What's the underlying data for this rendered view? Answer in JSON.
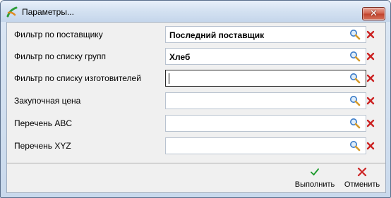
{
  "window": {
    "title": "Параметры..."
  },
  "filters": [
    {
      "label": "Фильтр по поставщику",
      "value": "Последний поставщик"
    },
    {
      "label": "Фильтр по списку групп",
      "value": "Хлеб"
    },
    {
      "label": "Фильтр по списку изготовителей",
      "value": ""
    },
    {
      "label": "Закупочная цена",
      "value": ""
    },
    {
      "label": "Перечень ABC",
      "value": ""
    },
    {
      "label": "Перечень XYZ",
      "value": ""
    }
  ],
  "actions": {
    "execute_label": "Выполнить",
    "cancel_label": "Отменить"
  },
  "icons": {
    "app": "app-logo-icon",
    "search": "magnifier-icon",
    "clear": "red-x-icon",
    "execute": "green-check-icon",
    "cancel": "red-x-icon"
  },
  "colors": {
    "close_button": "#c0412a",
    "check_green": "#1a9a2a",
    "clear_red": "#cc2222",
    "magnifier_glass": "#3b7bc8",
    "magnifier_handle": "#d59a2a"
  }
}
